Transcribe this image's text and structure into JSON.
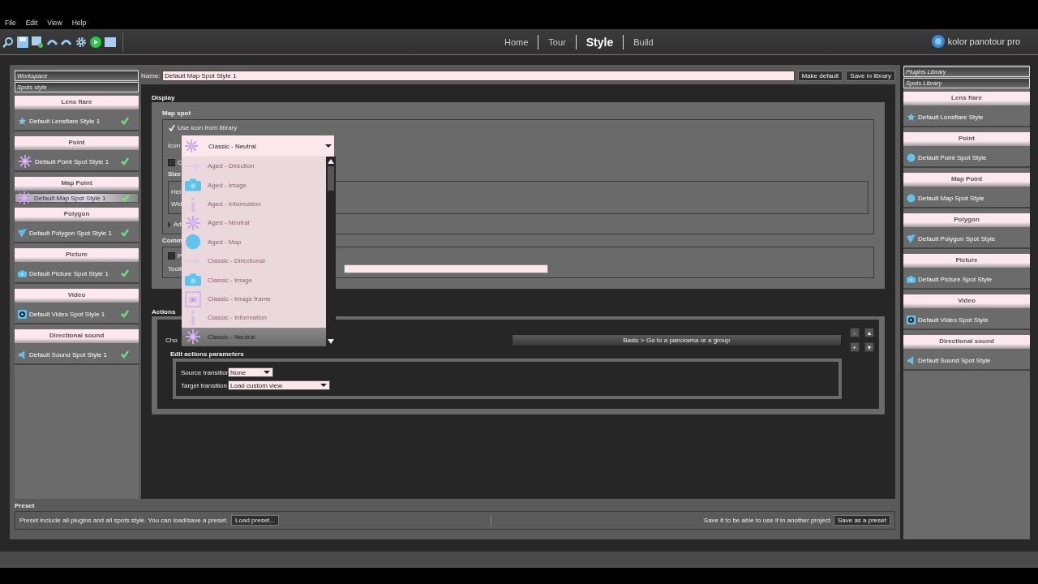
{
  "menu": [
    "File",
    "Edit",
    "View",
    "Help"
  ],
  "nav": [
    {
      "label": "Home",
      "selected": false
    },
    {
      "label": "Tour",
      "selected": false
    },
    {
      "label": "Style",
      "selected": true
    },
    {
      "label": "Build",
      "selected": false
    }
  ],
  "brand": "kolor panotour pro",
  "workspace": {
    "tabs": [
      "Workspace",
      "Spots style"
    ],
    "groups": [
      {
        "title": "Lens flare",
        "kind": "lensflare",
        "item": {
          "name": "Default Lensflare Style 1",
          "checked": true,
          "selected": false
        }
      },
      {
        "title": "Point",
        "kind": "point",
        "item": {
          "name": "Default Point Spot Style 1",
          "checked": true,
          "selected": false
        }
      },
      {
        "title": "Map Point",
        "kind": "mappoint",
        "item": {
          "name": "Default Map Spot Style 1",
          "checked": true,
          "selected": true
        }
      },
      {
        "title": "Polygon",
        "kind": "polygon",
        "item": {
          "name": "Default Polygon Spot Style 1",
          "checked": true,
          "selected": false
        }
      },
      {
        "title": "Picture",
        "kind": "picture",
        "item": {
          "name": "Default Picture Spot Style 1",
          "checked": true,
          "selected": false
        }
      },
      {
        "title": "Video",
        "kind": "video",
        "item": {
          "name": "Default Video Spot Style 1",
          "checked": true,
          "selected": false
        }
      },
      {
        "title": "Directional sound",
        "kind": "sound",
        "item": {
          "name": "Default Sound Spot Style 1",
          "checked": true,
          "selected": false
        }
      }
    ]
  },
  "editor": {
    "name_label": "Name:",
    "name_value": "Default Map Spot Style 1",
    "buttons": [
      "Make default",
      "Save in library"
    ],
    "display": {
      "title": "Display",
      "map_spot_title": "Map spot",
      "use_icon": {
        "label": "Use icon from library",
        "checked": true
      },
      "icon_label": "Icon",
      "icon_value": "Classic - Neutral",
      "option": {
        "label": "C",
        "checked": false
      },
      "size_title": "Size",
      "height_label": "Hei",
      "width_label": "Wid",
      "advanced_label": "Ad",
      "common_title": "Comm",
      "common_option": {
        "label": "P",
        "checked": false
      },
      "tooltip_label": "Toolt"
    },
    "dropdown": [
      {
        "label": "Aged - Direction",
        "kind": "direction",
        "selected": false
      },
      {
        "label": "Aged - Image",
        "kind": "image",
        "selected": false
      },
      {
        "label": "Aged - Information",
        "kind": "information",
        "selected": false
      },
      {
        "label": "Aged - Neutral",
        "kind": "neutral",
        "selected": false
      },
      {
        "label": "Aged - Map",
        "kind": "map",
        "selected": false
      },
      {
        "label": "Classic - Directional",
        "kind": "direction",
        "selected": false
      },
      {
        "label": "Classic - Image",
        "kind": "image",
        "selected": false
      },
      {
        "label": "Classic - Image frame",
        "kind": "frame",
        "selected": false
      },
      {
        "label": "Classic - Information",
        "kind": "information",
        "selected": false
      },
      {
        "label": "Classic - Neutral",
        "kind": "neutral",
        "selected": true
      }
    ],
    "actions": {
      "title": "Actions",
      "choice_label": "Cho",
      "choice": "Basic > Go to a panorama or a group",
      "controls": [
        "-",
        "▴",
        "+",
        "▾"
      ],
      "params_title": "Edit actions parameters",
      "source_label": "Source transition",
      "source_value": "None",
      "target_label": "Target transition",
      "target_value": "Load custom view"
    }
  },
  "preset": {
    "title": "Preset",
    "text": "Preset include all plugins and all spots style. You can load/save a preset.",
    "load_button": "Load preset...",
    "save_text": "Save it to be able to use it in another project",
    "save_button": "Save as a preset"
  },
  "library": {
    "tabs": [
      "Plugins Library",
      "Spots Library"
    ],
    "groups": [
      {
        "title": "Lens flare",
        "kind": "lensflare",
        "item": "Default Lensflare Style"
      },
      {
        "title": "Point",
        "kind": "point",
        "item": "Default Point Spot Style"
      },
      {
        "title": "Map Point",
        "kind": "mappoint",
        "item": "Default Map Spot Style"
      },
      {
        "title": "Polygon",
        "kind": "polygon",
        "item": "Default Polygon Spot Style"
      },
      {
        "title": "Picture",
        "kind": "picture",
        "item": "Default Picture Spot Style"
      },
      {
        "title": "Video",
        "kind": "video",
        "item": "Default Video Spot Style"
      },
      {
        "title": "Directional sound",
        "kind": "sound",
        "item": "Default Sound Spot Style"
      }
    ]
  }
}
